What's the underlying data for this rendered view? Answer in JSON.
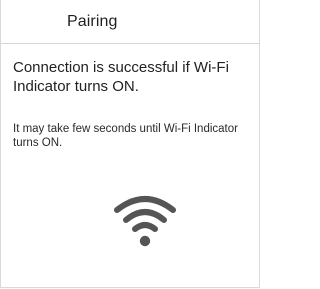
{
  "header": {
    "title": "Pairing"
  },
  "content": {
    "primary_text": "Connection is successful if Wi-Fi Indicator turns ON.",
    "secondary_text": "It may take few seconds until Wi-Fi Indicator turns ON."
  },
  "icons": {
    "status_icon": "wifi-icon",
    "status_icon_color": "#555555"
  }
}
